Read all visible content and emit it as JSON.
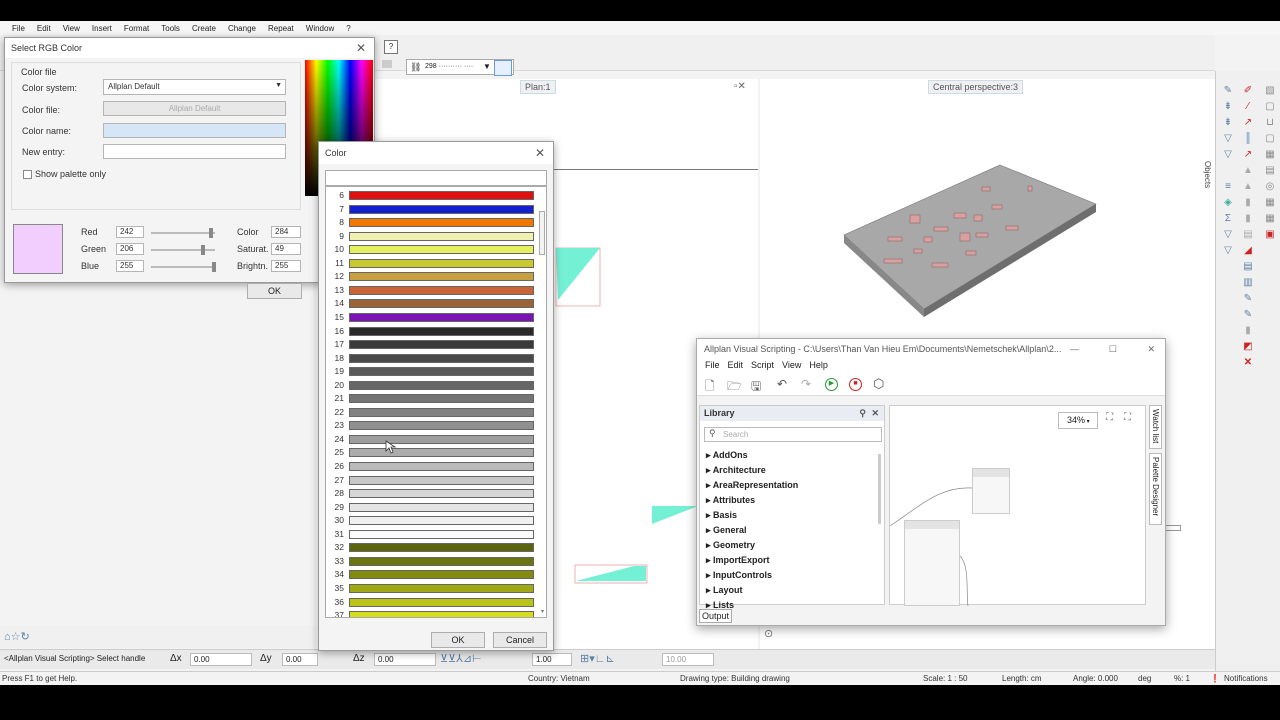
{
  "menu": [
    "File",
    "Edit",
    "View",
    "Insert",
    "Format",
    "Tools",
    "Create",
    "Change",
    "Repeat",
    "Window",
    "?"
  ],
  "toolbar": {
    "scale_value": "298 ·········· ····"
  },
  "viewports": {
    "plan_title": "Plan:1",
    "perspective_title": "Central perspective:3"
  },
  "right_panel": {
    "objects_label": "Objects"
  },
  "rgb_dialog": {
    "title": "Select RGB Color",
    "group_label": "Color file",
    "color_system_label": "Color system:",
    "color_system_value": "Allplan Default",
    "color_file_label": "Color file:",
    "color_file_value": "Allplan Default",
    "color_name_label": "Color name:",
    "new_entry_label": "New entry:",
    "show_palette_label": "Show palette only",
    "red_label": "Red",
    "red_value": "242",
    "green_label": "Green",
    "green_value": "206",
    "blue_label": "Blue",
    "blue_value": "255",
    "color_label": "Color",
    "color_value": "284",
    "saturat_label": "Saturat.",
    "saturat_value": "49",
    "brightn_label": "Brightn.",
    "brightn_value": "255",
    "ok_label": "OK",
    "preview_color": "#f2ceff"
  },
  "color_dialog": {
    "title": "Color",
    "ok_label": "OK",
    "cancel_label": "Cancel",
    "rows": [
      {
        "num": "6",
        "color": "#e01010"
      },
      {
        "num": "7",
        "color": "#1420d0"
      },
      {
        "num": "8",
        "color": "#f07800"
      },
      {
        "num": "9",
        "color": "#f0f0b0"
      },
      {
        "num": "10",
        "color": "#e4f060"
      },
      {
        "num": "11",
        "color": "#c8c830"
      },
      {
        "num": "12",
        "color": "#c8a040"
      },
      {
        "num": "13",
        "color": "#c86438"
      },
      {
        "num": "14",
        "color": "#9a6438"
      },
      {
        "num": "15",
        "color": "#7a14b4"
      },
      {
        "num": "16",
        "color": "#2a2a2a"
      },
      {
        "num": "17",
        "color": "#3a3a3a"
      },
      {
        "num": "18",
        "color": "#4a4a4a"
      },
      {
        "num": "19",
        "color": "#5a5a5a"
      },
      {
        "num": "20",
        "color": "#666666"
      },
      {
        "num": "21",
        "color": "#747474"
      },
      {
        "num": "22",
        "color": "#828282"
      },
      {
        "num": "23",
        "color": "#909090"
      },
      {
        "num": "24",
        "color": "#9e9e9e"
      },
      {
        "num": "25",
        "color": "#acacac"
      },
      {
        "num": "26",
        "color": "#bababa"
      },
      {
        "num": "27",
        "color": "#c8c8c8"
      },
      {
        "num": "28",
        "color": "#d6d6d6"
      },
      {
        "num": "29",
        "color": "#e4e4e4"
      },
      {
        "num": "30",
        "color": "#f0f0f0"
      },
      {
        "num": "31",
        "color": "#fafafa"
      },
      {
        "num": "32",
        "color": "#5a6410"
      },
      {
        "num": "33",
        "color": "#6a7410"
      },
      {
        "num": "34",
        "color": "#828a10"
      },
      {
        "num": "35",
        "color": "#a0a814"
      },
      {
        "num": "36",
        "color": "#bcc418"
      },
      {
        "num": "37",
        "color": "#d4dc1c"
      }
    ]
  },
  "avs": {
    "title": "Allplan Visual Scripting - C:\\Users\\Than Van Hieu Em\\Documents\\Nemetschek\\Allplan\\2...",
    "menu": [
      "File",
      "Edit",
      "Script",
      "View",
      "Help"
    ],
    "library_title": "Library",
    "search_placeholder": "Search",
    "library_items": [
      "AddOns",
      "Architecture",
      "AreaRepresentation",
      "Attributes",
      "Basis",
      "General",
      "Geometry",
      "ImportExport",
      "InputControls",
      "Layout",
      "Lists"
    ],
    "zoom": "34%",
    "watch_list": "Watch list",
    "palette_designer": "Palette Designer",
    "output_tab": "Output"
  },
  "command_bar": {
    "prompt": "<Allplan Visual Scripting> Select handle",
    "dx_label": "Δx",
    "dx_value": "0.00",
    "dy_label": "Δy",
    "dy_value": "0.00",
    "dz_label": "Δz",
    "dz_value": "0.00",
    "factor_value": "1.00",
    "dist_value": "10.00"
  },
  "status": {
    "help": "Press F1 to get Help.",
    "country": "Country: Vietnam",
    "drawing_type": "Drawing type: Building drawing",
    "scale": "Scale: 1 : 50",
    "length": "Length: cm",
    "angle": "Angle: 0.000",
    "angle_unit": "deg",
    "percent": "%: 1",
    "notifications": "Notifications"
  }
}
